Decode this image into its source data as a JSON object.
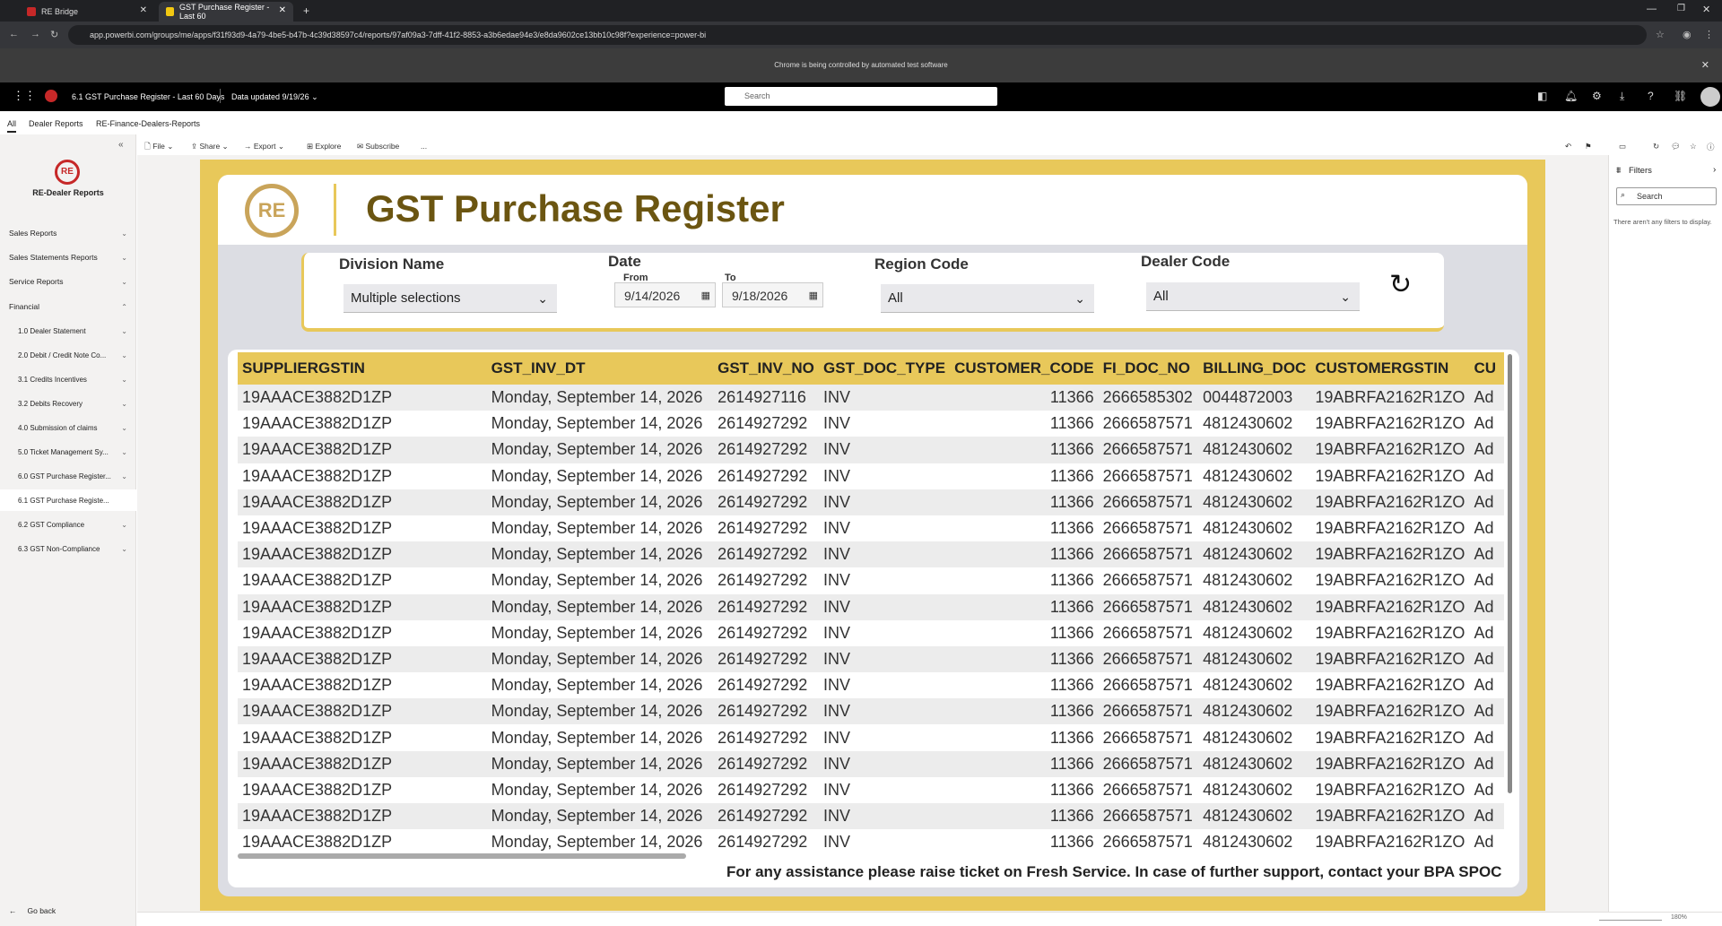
{
  "browser": {
    "tabs": [
      {
        "label": "RE Bridge"
      },
      {
        "label": "GST Purchase Register - Last 60"
      }
    ],
    "url": "app.powerbi.com/groups/me/apps/f31f93d9-4a79-4be5-b47b-4c39d38597c4/reports/97af09a3-7dff-41f2-8853-a3b6edae94e3/e8da9602ce13bb10c98f?experience=power-bi",
    "automation_notice": "Chrome is being controlled by automated test software"
  },
  "pbi_header": {
    "report_title": "6.1 GST Purchase Register - Last 60 Days",
    "data_updated": "Data updated 9/19/26",
    "search_placeholder": "Search"
  },
  "nav_tabs": [
    "All",
    "Dealer Reports",
    "RE-Finance-Dealers-Reports"
  ],
  "sidebar": {
    "app_name": "RE-Dealer Reports",
    "items": [
      {
        "label": "Sales Reports"
      },
      {
        "label": "Sales Statements Reports"
      },
      {
        "label": "Service Reports"
      },
      {
        "label": "Financial"
      },
      {
        "label": "1.0 Dealer Statement"
      },
      {
        "label": "2.0 Debit / Credit Note Co..."
      },
      {
        "label": "3.1 Credits Incentives"
      },
      {
        "label": "3.2 Debits Recovery"
      },
      {
        "label": "4.0 Submission of claims"
      },
      {
        "label": "5.0 Ticket Management Sy..."
      },
      {
        "label": "6.0 GST Purchase Register..."
      },
      {
        "label": "6.1 GST Purchase Registe..."
      },
      {
        "label": "6.2 GST Compliance"
      },
      {
        "label": "6.3 GST Non-Compliance"
      }
    ],
    "go_back": "Go back"
  },
  "toolbar": {
    "file": "File",
    "share": "Share",
    "export": "Export",
    "explore": "Explore",
    "subscribe": "Subscribe",
    "more": "..."
  },
  "report": {
    "title": "GST Purchase Register",
    "filters": {
      "division_label": "Division Name",
      "division_value": "Multiple selections",
      "date_label": "Date",
      "from_label": "From",
      "to_label": "To",
      "from_value": "9/14/2026",
      "to_value": "9/18/2026",
      "region_label": "Region Code",
      "region_value": "All",
      "dealer_label": "Dealer Code",
      "dealer_value": "All"
    },
    "columns": [
      "SUPPLIERGSTIN",
      "GST_INV_DT",
      "GST_INV_NO",
      "GST_DOC_TYPE",
      "CUSTOMER_CODE",
      "FI_DOC_NO",
      "BILLING_DOC",
      "CUSTOMERGSTIN",
      "CU"
    ],
    "rows": [
      [
        "19AAACE3882D1ZP",
        "Monday, September 14, 2026",
        "2614927116",
        "INV",
        "11366",
        "2666585302",
        "0044872003",
        "19ABRFA2162R1ZO",
        "Ad"
      ],
      [
        "19AAACE3882D1ZP",
        "Monday, September 14, 2026",
        "2614927292",
        "INV",
        "11366",
        "2666587571",
        "4812430602",
        "19ABRFA2162R1ZO",
        "Ad"
      ],
      [
        "19AAACE3882D1ZP",
        "Monday, September 14, 2026",
        "2614927292",
        "INV",
        "11366",
        "2666587571",
        "4812430602",
        "19ABRFA2162R1ZO",
        "Ad"
      ],
      [
        "19AAACE3882D1ZP",
        "Monday, September 14, 2026",
        "2614927292",
        "INV",
        "11366",
        "2666587571",
        "4812430602",
        "19ABRFA2162R1ZO",
        "Ad"
      ],
      [
        "19AAACE3882D1ZP",
        "Monday, September 14, 2026",
        "2614927292",
        "INV",
        "11366",
        "2666587571",
        "4812430602",
        "19ABRFA2162R1ZO",
        "Ad"
      ],
      [
        "19AAACE3882D1ZP",
        "Monday, September 14, 2026",
        "2614927292",
        "INV",
        "11366",
        "2666587571",
        "4812430602",
        "19ABRFA2162R1ZO",
        "Ad"
      ],
      [
        "19AAACE3882D1ZP",
        "Monday, September 14, 2026",
        "2614927292",
        "INV",
        "11366",
        "2666587571",
        "4812430602",
        "19ABRFA2162R1ZO",
        "Ad"
      ],
      [
        "19AAACE3882D1ZP",
        "Monday, September 14, 2026",
        "2614927292",
        "INV",
        "11366",
        "2666587571",
        "4812430602",
        "19ABRFA2162R1ZO",
        "Ad"
      ],
      [
        "19AAACE3882D1ZP",
        "Monday, September 14, 2026",
        "2614927292",
        "INV",
        "11366",
        "2666587571",
        "4812430602",
        "19ABRFA2162R1ZO",
        "Ad"
      ],
      [
        "19AAACE3882D1ZP",
        "Monday, September 14, 2026",
        "2614927292",
        "INV",
        "11366",
        "2666587571",
        "4812430602",
        "19ABRFA2162R1ZO",
        "Ad"
      ],
      [
        "19AAACE3882D1ZP",
        "Monday, September 14, 2026",
        "2614927292",
        "INV",
        "11366",
        "2666587571",
        "4812430602",
        "19ABRFA2162R1ZO",
        "Ad"
      ],
      [
        "19AAACE3882D1ZP",
        "Monday, September 14, 2026",
        "2614927292",
        "INV",
        "11366",
        "2666587571",
        "4812430602",
        "19ABRFA2162R1ZO",
        "Ad"
      ],
      [
        "19AAACE3882D1ZP",
        "Monday, September 14, 2026",
        "2614927292",
        "INV",
        "11366",
        "2666587571",
        "4812430602",
        "19ABRFA2162R1ZO",
        "Ad"
      ],
      [
        "19AAACE3882D1ZP",
        "Monday, September 14, 2026",
        "2614927292",
        "INV",
        "11366",
        "2666587571",
        "4812430602",
        "19ABRFA2162R1ZO",
        "Ad"
      ],
      [
        "19AAACE3882D1ZP",
        "Monday, September 14, 2026",
        "2614927292",
        "INV",
        "11366",
        "2666587571",
        "4812430602",
        "19ABRFA2162R1ZO",
        "Ad"
      ],
      [
        "19AAACE3882D1ZP",
        "Monday, September 14, 2026",
        "2614927292",
        "INV",
        "11366",
        "2666587571",
        "4812430602",
        "19ABRFA2162R1ZO",
        "Ad"
      ],
      [
        "19AAACE3882D1ZP",
        "Monday, September 14, 2026",
        "2614927292",
        "INV",
        "11366",
        "2666587571",
        "4812430602",
        "19ABRFA2162R1ZO",
        "Ad"
      ],
      [
        "19AAACE3882D1ZP",
        "Monday, September 14, 2026",
        "2614927292",
        "INV",
        "11366",
        "2666587571",
        "4812430602",
        "19ABRFA2162R1ZO",
        "Ad"
      ]
    ],
    "footer": "For any assistance please raise ticket on Fresh Service. In case of further support, contact your BPA SPOC"
  },
  "filters_pane": {
    "title": "Filters",
    "search_placeholder": "Search",
    "empty_message": "There aren't any filters to display."
  },
  "status": {
    "zoom": "180%"
  },
  "colors": {
    "accent_yellow": "#e8c85a",
    "title_brown": "#6b5511"
  }
}
